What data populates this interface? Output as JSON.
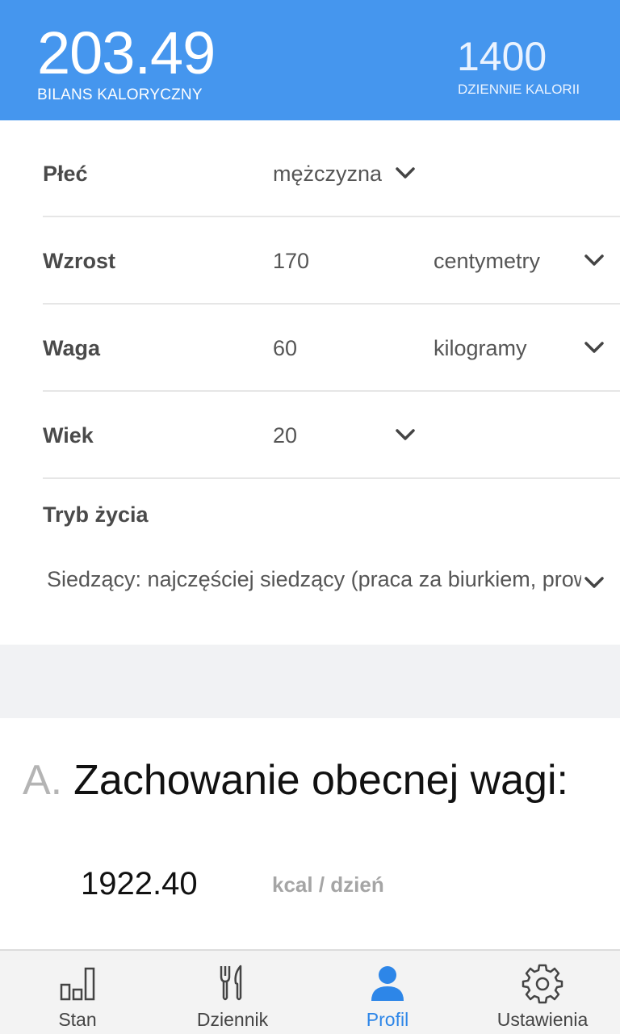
{
  "header": {
    "balance_value": "203.49",
    "balance_label": "BILANS KALORYCZNY",
    "daily_value": "1400",
    "daily_label": "DZIENNIE KALORII"
  },
  "profile": {
    "gender": {
      "label": "Płeć",
      "value": "mężczyzna"
    },
    "height": {
      "label": "Wzrost",
      "value": "170",
      "unit": "centymetry"
    },
    "weight": {
      "label": "Waga",
      "value": "60",
      "unit": "kilogramy"
    },
    "age": {
      "label": "Wiek",
      "value": "20"
    },
    "lifestyle": {
      "label": "Tryb życia",
      "value": "Siedzący: najczęściej siedzący (praca za biurkiem, prowadzenie samochodu)"
    }
  },
  "section_a": {
    "letter": "A.",
    "title": "Zachowanie obecnej wagi:",
    "kcal_value": "1922.40",
    "kcal_unit": "kcal / dzień"
  },
  "nav": {
    "items": [
      {
        "label": "Stan",
        "icon": "bar-chart-icon",
        "active": false
      },
      {
        "label": "Dziennik",
        "icon": "fork-knife-icon",
        "active": false
      },
      {
        "label": "Profil",
        "icon": "person-icon",
        "active": true
      },
      {
        "label": "Ustawienia",
        "icon": "gear-icon",
        "active": false
      }
    ]
  },
  "colors": {
    "header_bg": "#4596ee",
    "accent": "#2d86e8",
    "divider": "#f1f2f4"
  }
}
